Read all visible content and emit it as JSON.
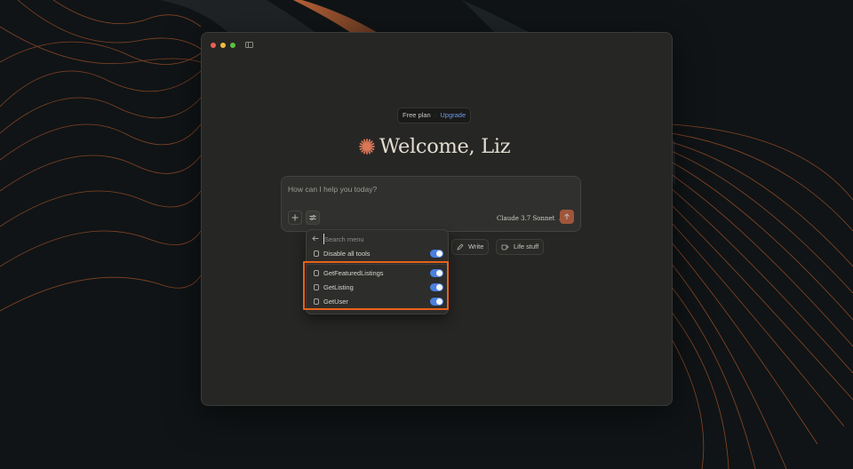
{
  "colors": {
    "accent": "#c5633e",
    "toggle_on": "#4a7fe0",
    "highlight": "#e8621c",
    "upgrade_link": "#6b98ea"
  },
  "plan": {
    "label": "Free plan",
    "separator": "·",
    "upgrade_label": "Upgrade"
  },
  "welcome": {
    "icon": "claude-spark-icon",
    "text": "Welcome, Liz"
  },
  "chat": {
    "placeholder": "How can I help you today?",
    "model": "Claude 3.7 Sonnet"
  },
  "chips": [
    {
      "label": "Write",
      "icon": "pencil-icon"
    },
    {
      "label": "Life stuff",
      "icon": "coffee-cup-icon"
    }
  ],
  "tools_menu": {
    "search_placeholder": "Search menu",
    "disable_all": {
      "label": "Disable all tools",
      "enabled": true
    },
    "tools": [
      {
        "label": "GetFeaturedListings",
        "enabled": true
      },
      {
        "label": "GetListing",
        "enabled": true
      },
      {
        "label": "GetUser",
        "enabled": true
      }
    ]
  }
}
